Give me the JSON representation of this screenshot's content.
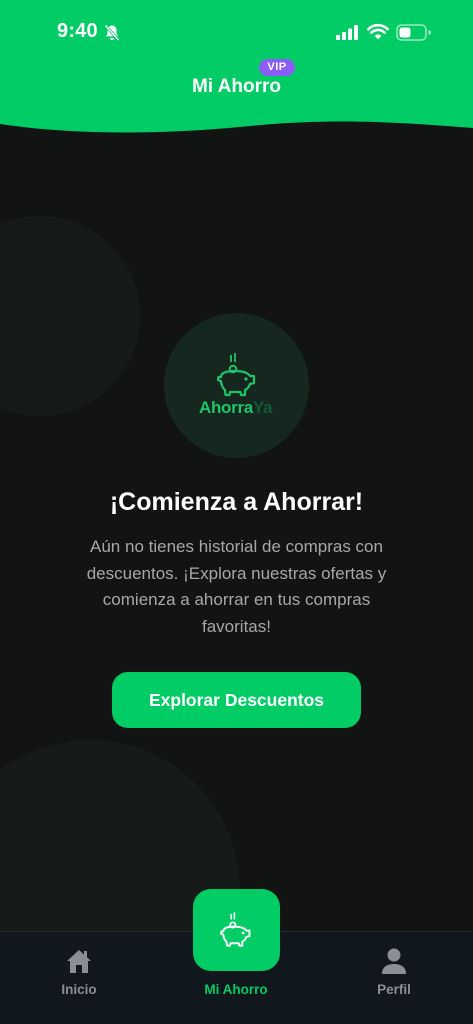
{
  "status_bar": {
    "time": "9:40"
  },
  "header": {
    "title": "Mi Ahorro",
    "badge": "VIP"
  },
  "logo": {
    "text_primary": "Ahorra",
    "text_secondary": "Ya"
  },
  "empty_state": {
    "headline": "¡Comienza a Ahorrar!",
    "description": "Aún no tienes historial de compras con descuentos. ¡Explora nuestras ofertas y comienza a ahorrar en tus compras favoritas!",
    "cta_label": "Explorar Descuentos"
  },
  "tabbar": {
    "items": [
      {
        "label": "Inicio",
        "icon": "home-icon",
        "active": false
      },
      {
        "label": "Mi Ahorro",
        "icon": "piggy-bank-icon",
        "active": true
      },
      {
        "label": "Perfil",
        "icon": "user-icon",
        "active": false
      }
    ]
  },
  "colors": {
    "accent": "#00cc66",
    "background": "#121414",
    "badge": "#8b5cf6",
    "tabbar": "#11181d"
  }
}
